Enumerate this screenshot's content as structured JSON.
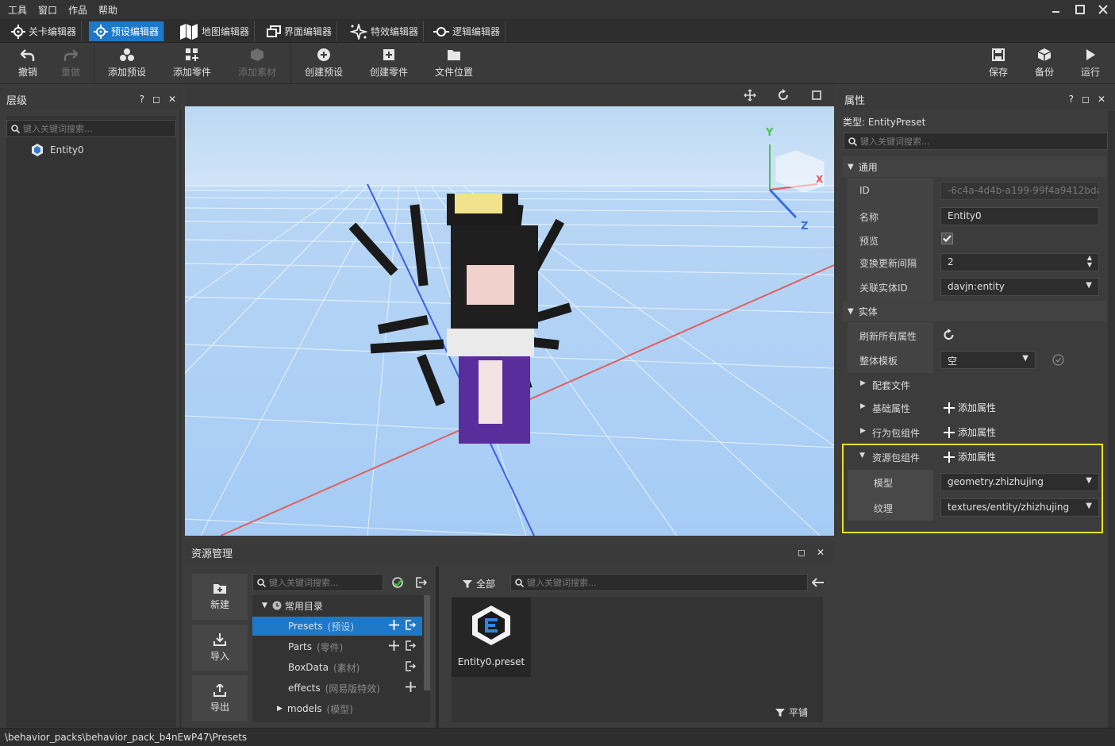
{
  "menu": [
    "工具",
    "窗口",
    "作品",
    "帮助"
  ],
  "editor_tabs": [
    {
      "label": "关卡编辑器",
      "icon": "crosshair-icon",
      "active": false
    },
    {
      "label": "预设编辑器",
      "icon": "crosshair-icon",
      "active": true
    },
    {
      "label": "地图编辑器",
      "icon": "map-icon",
      "active": false
    },
    {
      "label": "界面编辑器",
      "icon": "layout-icon",
      "active": false
    },
    {
      "label": "特效编辑器",
      "icon": "sparkle-icon",
      "active": false
    },
    {
      "label": "逻辑编辑器",
      "icon": "logic-icon",
      "active": false
    }
  ],
  "toolbar": {
    "undo": "撤销",
    "redo": "重做",
    "add_preset": "添加预设",
    "add_part": "添加零件",
    "add_material": "添加素材",
    "create_preset": "创建预设",
    "create_part": "创建零件",
    "file_location": "文件位置",
    "save": "保存",
    "backup": "备份",
    "run": "运行"
  },
  "hierarchy": {
    "title": "层级",
    "search_placeholder": "键入关键词搜索...",
    "items": [
      "Entity0"
    ]
  },
  "viewport": {
    "axis_x": "X",
    "axis_y": "Y",
    "axis_z": "Z"
  },
  "properties": {
    "title": "属性",
    "type_label": "类型: EntityPreset",
    "search_placeholder": "键入关键词搜索...",
    "general": {
      "section": "通用",
      "id_label": "ID",
      "id_value": "-6c4a-4d4b-a199-99f4a9412bda",
      "name_label": "名称",
      "name_value": "Entity0",
      "preview_label": "预览",
      "interval_label": "变换更新间隔",
      "interval_value": "2",
      "entity_id_label": "关联实体ID",
      "entity_id_value": "davjn:entity"
    },
    "entity": {
      "section": "实体",
      "refresh_label": "刷新所有属性",
      "template_label": "整体模板",
      "template_value": "空",
      "config_files": "配套文件",
      "basic_props": "基础属性",
      "behavior_comp": "行为包组件",
      "resource_comp": "资源包组件",
      "add_prop": "添加属性",
      "model_label": "模型",
      "model_value": "geometry.zhizhujing",
      "texture_label": "纹理",
      "texture_value": "textures/entity/zhizhujing"
    }
  },
  "resources": {
    "title": "资源管理",
    "new": "新建",
    "import": "导入",
    "export": "导出",
    "search_placeholder": "键入关键词搜索...",
    "common_dir": "常用目录",
    "tree": [
      {
        "name": "Presets",
        "cn": "(预设)"
      },
      {
        "name": "Parts",
        "cn": "(零件)"
      },
      {
        "name": "BoxData",
        "cn": "(素材)"
      },
      {
        "name": "effects",
        "cn": "(网易版特效)"
      },
      {
        "name": "models",
        "cn": "(模型)"
      }
    ],
    "filter_all": "全部",
    "file_search_placeholder": "键入关键词搜索...",
    "file_name": "Entity0.preset",
    "tile_label": "平铺"
  },
  "status_path": "\\behavior_packs\\behavior_pack_b4nEwP47\\Presets",
  "colors": {
    "accent": "#1e78c8",
    "highlight": "#f0e020",
    "axis_x": "#e05a5a",
    "axis_y": "#49c44a",
    "axis_z": "#3b6fe0"
  }
}
